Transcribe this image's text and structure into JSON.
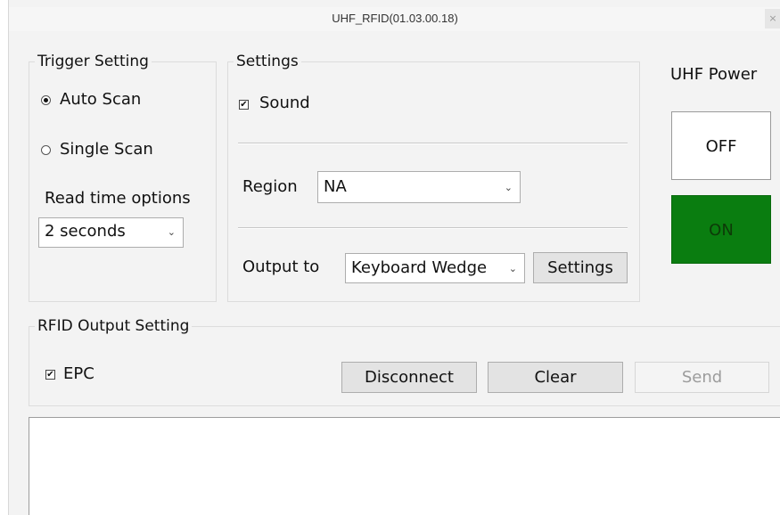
{
  "window": {
    "title": "UHF_RFID(01.03.00.18)",
    "close_label": "×"
  },
  "trigger": {
    "legend": "Trigger Setting",
    "auto_scan_label": "Auto Scan",
    "auto_scan_selected": true,
    "single_scan_label": "Single Scan",
    "single_scan_selected": false,
    "read_time_label": "Read time options",
    "read_time_value": "2 seconds"
  },
  "settings": {
    "legend": "Settings",
    "sound_label": "Sound",
    "sound_checked": true,
    "region_label": "Region",
    "region_value": "NA",
    "output_label": "Output to",
    "output_value": "Keyboard Wedge",
    "settings_button": "Settings"
  },
  "power": {
    "label": "UHF Power",
    "off_label": "OFF",
    "on_label": "ON",
    "on_color": "#0a7d10"
  },
  "rfid_output": {
    "legend": "RFID Output Setting",
    "epc_label": "EPC",
    "epc_checked": true,
    "disconnect_button": "Disconnect",
    "clear_button": "Clear",
    "send_button": "Send"
  },
  "icons": {
    "check": "✔",
    "chevron": "⌄"
  }
}
